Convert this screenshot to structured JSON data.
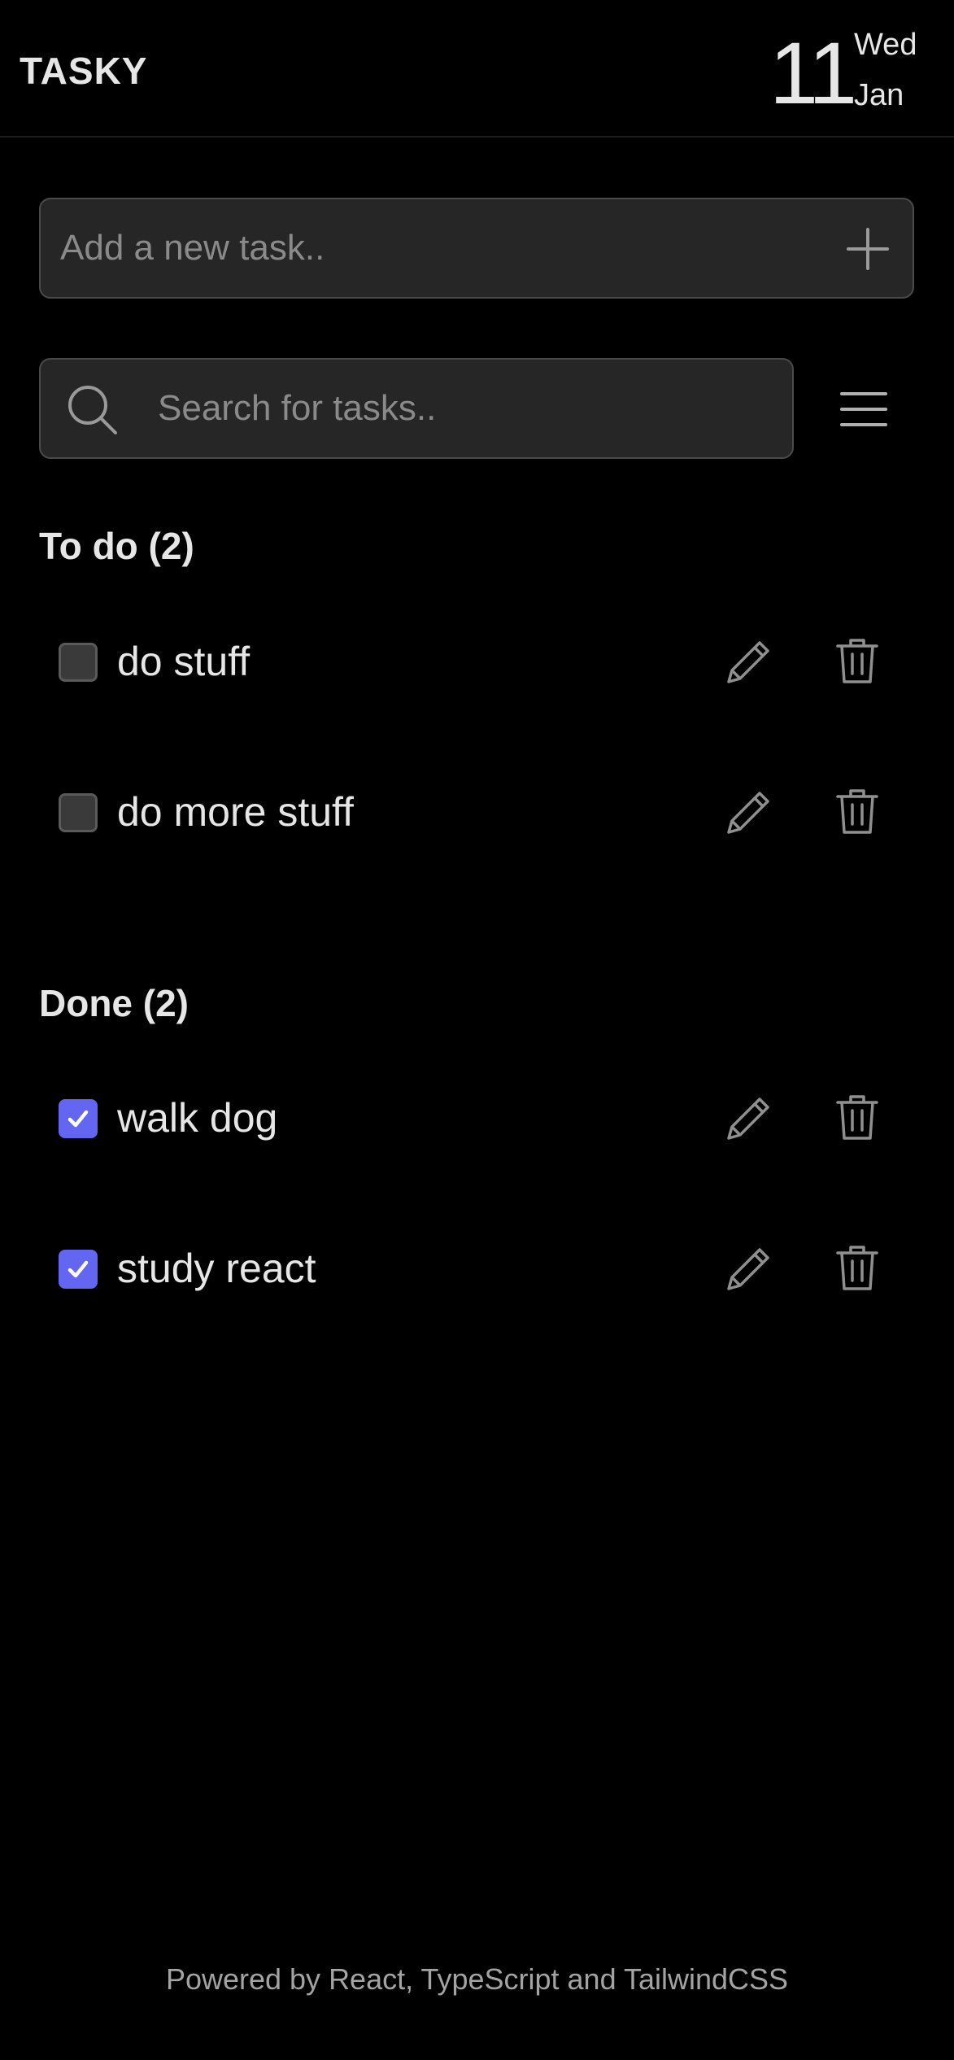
{
  "header": {
    "app_title": "TASKY",
    "date_day": "11",
    "date_weekday": "Wed",
    "date_month": "Jan"
  },
  "add_task": {
    "placeholder": "Add a new task..",
    "value": "",
    "button_icon": "plus-icon"
  },
  "search": {
    "placeholder": "Search for tasks..",
    "value": "",
    "icon": "search-icon",
    "menu_icon": "hamburger-menu-icon"
  },
  "todo": {
    "title": "To do (2)",
    "tasks": [
      {
        "label": "do stuff",
        "done": false
      },
      {
        "label": "do more stuff",
        "done": false
      }
    ]
  },
  "done": {
    "title": "Done (2)",
    "tasks": [
      {
        "label": "walk dog",
        "done": true
      },
      {
        "label": "study react",
        "done": true
      }
    ]
  },
  "footer": {
    "text": "Powered by React, TypeScript and TailwindCSS"
  },
  "colors": {
    "background": "#000000",
    "input_bg": "#262626",
    "accent": "#6366f1",
    "icon_gray": "#8f8f8f"
  }
}
